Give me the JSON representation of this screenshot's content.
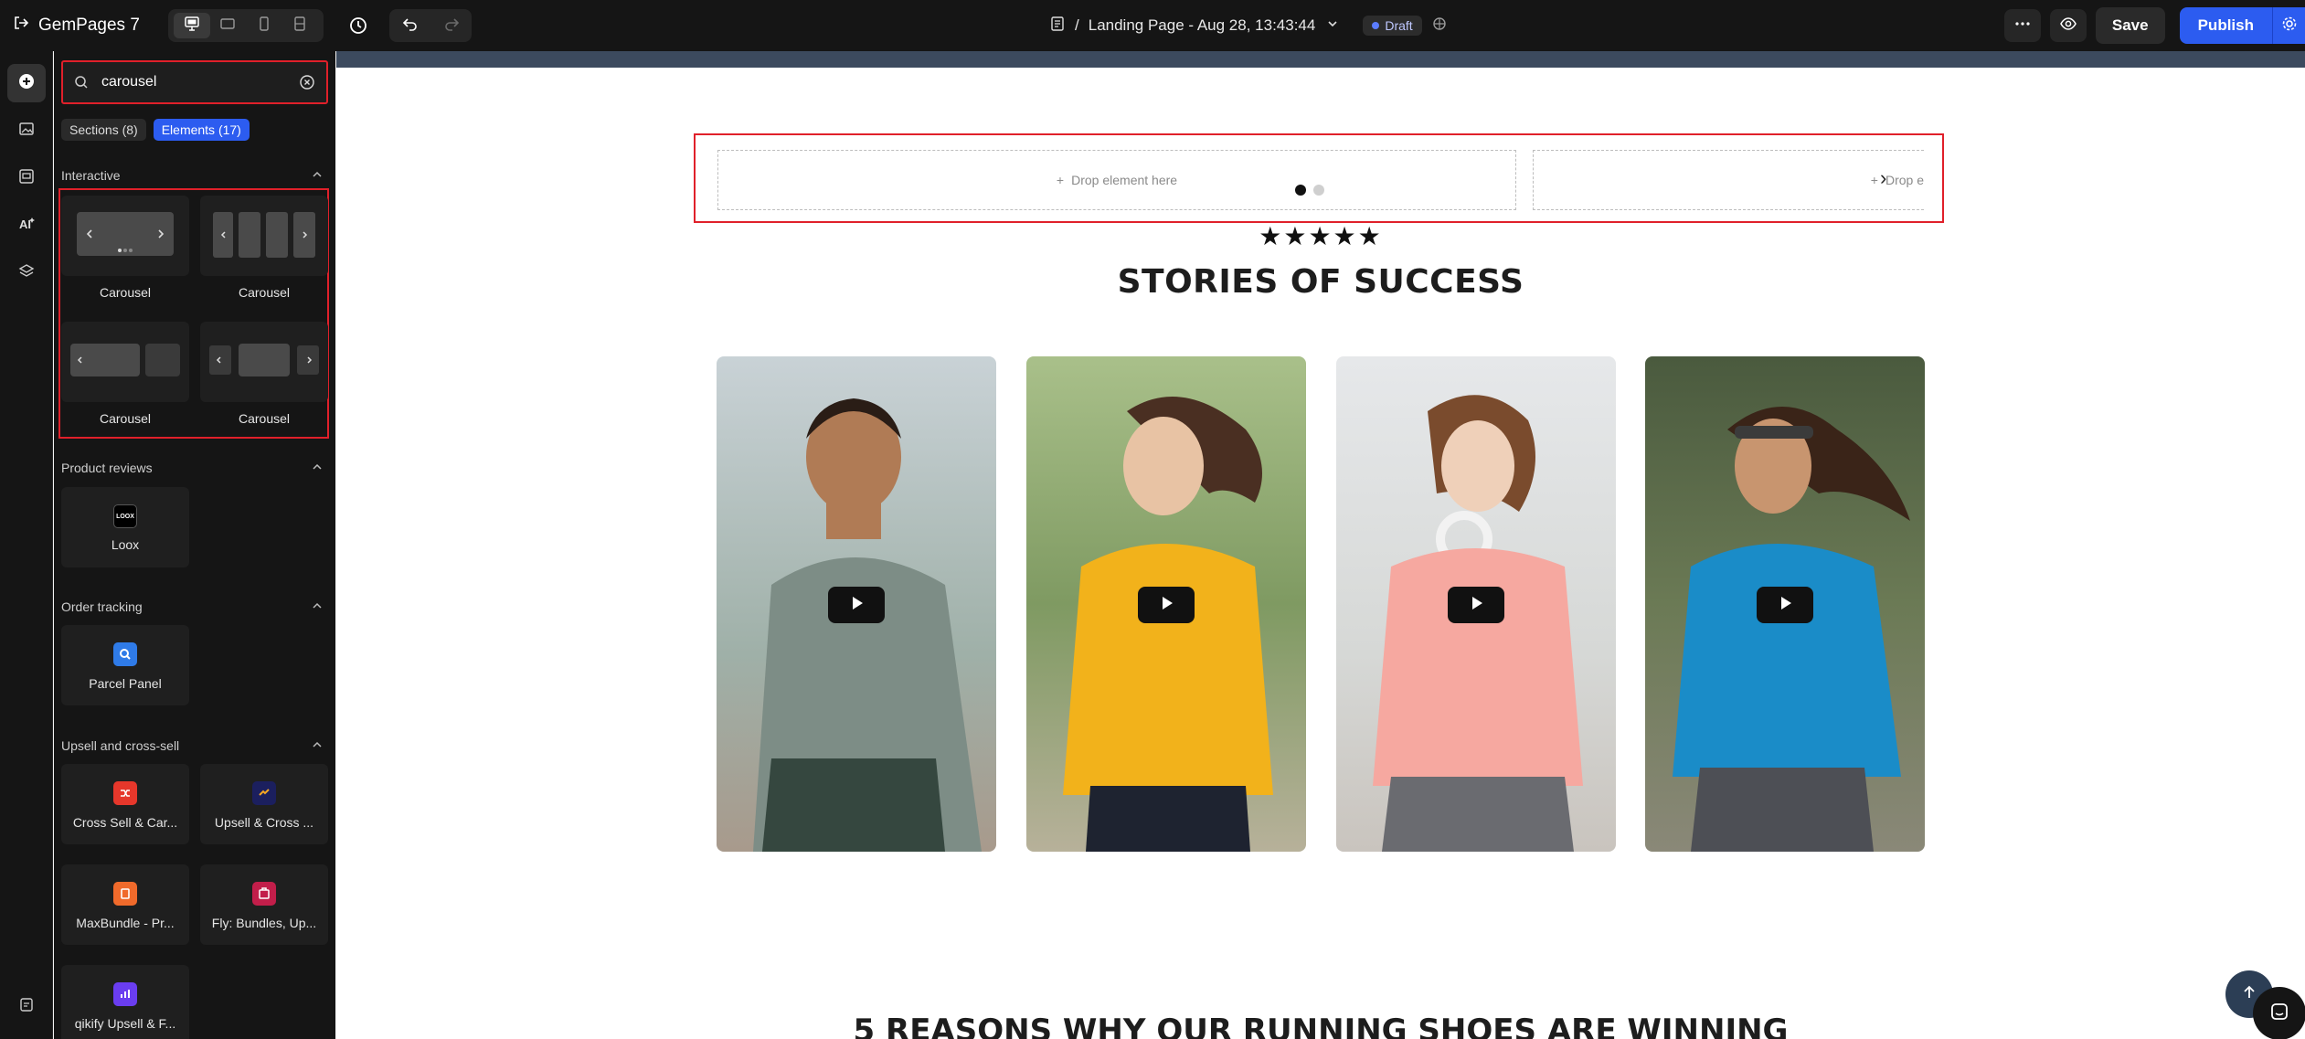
{
  "app": {
    "name": "GemPages 7"
  },
  "header": {
    "breadcrumb_sep": "/",
    "page_title": "Landing Page - Aug 28, 13:43:44",
    "status": "Draft",
    "save_label": "Save",
    "publish_label": "Publish"
  },
  "panel": {
    "search_value": "carousel",
    "tabs": [
      {
        "label": "Sections (8)"
      },
      {
        "label": "Elements (17)"
      }
    ],
    "groups": {
      "interactive": {
        "title": "Interactive",
        "items": [
          "Carousel",
          "Carousel",
          "Carousel",
          "Carousel"
        ]
      },
      "product_reviews": {
        "title": "Product reviews",
        "items": [
          "Loox"
        ]
      },
      "order_tracking": {
        "title": "Order tracking",
        "items": [
          "Parcel Panel"
        ]
      },
      "upsell": {
        "title": "Upsell and cross-sell",
        "items": [
          "Cross Sell & Car...",
          "Upsell & Cross ...",
          "MaxBundle - Pr...",
          "Fly: Bundles, Up...",
          "qikify Upsell & F..."
        ]
      }
    }
  },
  "canvas": {
    "drop_label": "Drop element here",
    "drop_label_cut": "Drop e",
    "stars": "★★★★★",
    "heading": "STORIES OF SUCCESS",
    "next_heading": "5 REASONS WHY OUR RUNNING SHOES ARE WINNING"
  },
  "colors": {
    "accent": "#2c5cf0",
    "selection": "#e0202a",
    "dark_bg": "#151515"
  }
}
